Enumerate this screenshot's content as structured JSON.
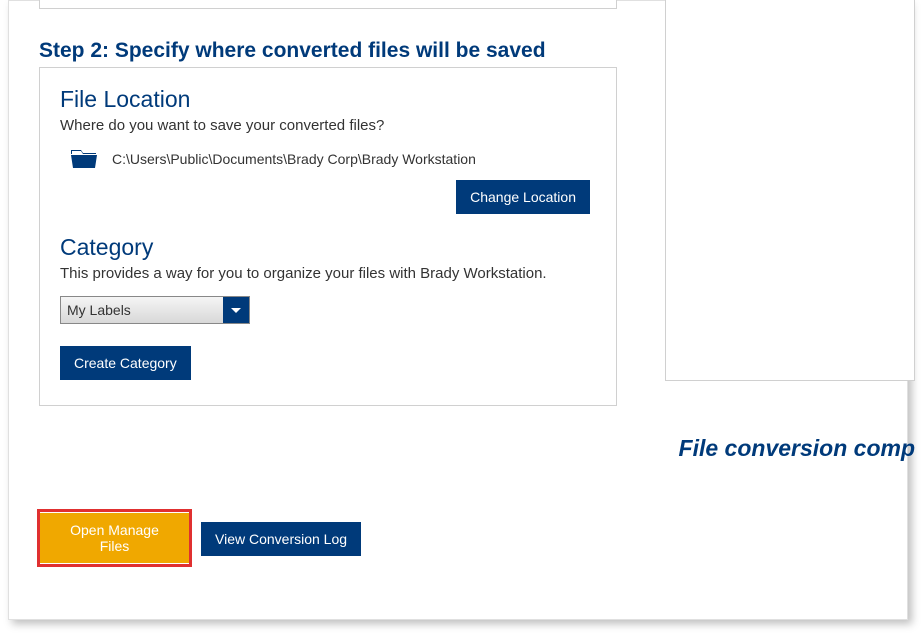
{
  "step": {
    "heading": "Step 2: Specify where converted files will be saved",
    "fileLocation": {
      "title": "File Location",
      "desc": "Where do you want to save your converted files?",
      "path": "C:\\Users\\Public\\Documents\\Brady Corp\\Brady Workstation",
      "changeButton": "Change Location"
    },
    "category": {
      "title": "Category",
      "desc": "This provides a way for you to organize your files with Brady Workstation.",
      "selected": "My Labels",
      "createButton": "Create Category"
    }
  },
  "buttons": {
    "openManage": "Open Manage Files",
    "viewLog": "View Conversion Log"
  },
  "status": "File conversion comp"
}
